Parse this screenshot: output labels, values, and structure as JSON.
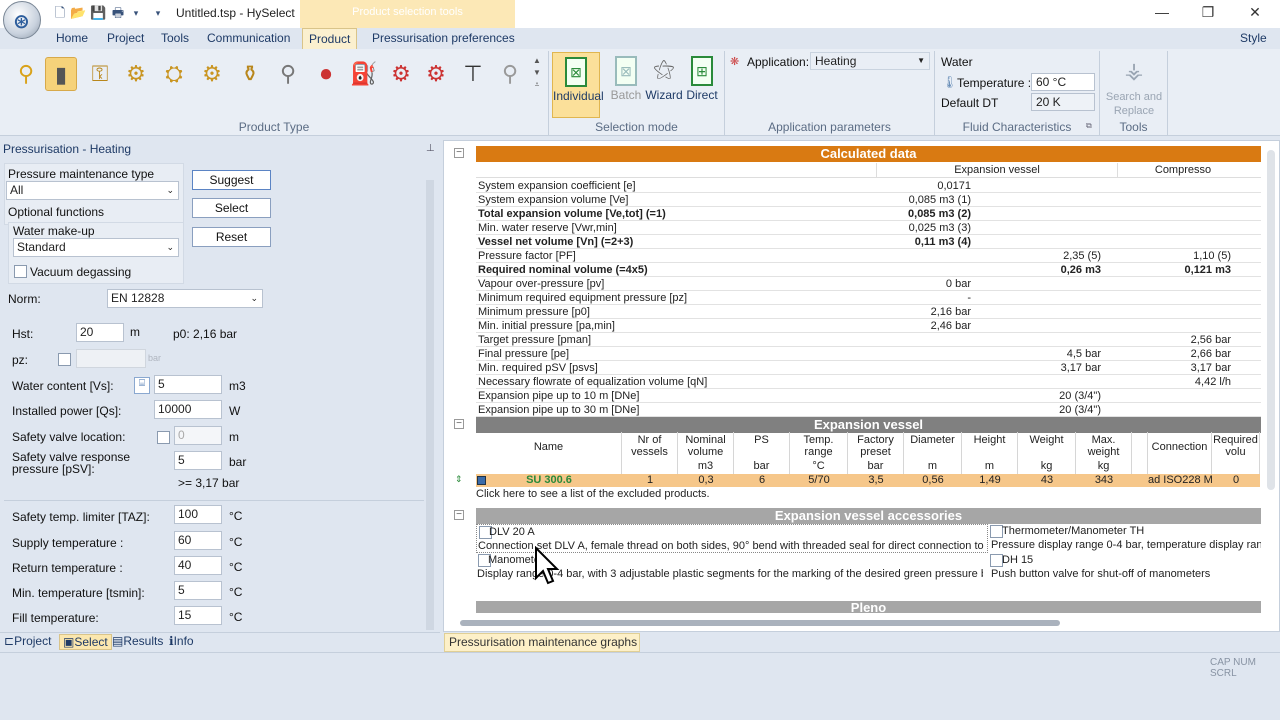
{
  "window": {
    "title": "Untitled.tsp - HySelect",
    "context_tab": "Product selection tools",
    "style_label": "Style"
  },
  "tabs": [
    "Home",
    "Project",
    "Tools",
    "Communication",
    "Product",
    "Pressurisation preferences"
  ],
  "ribbon": {
    "groups": {
      "product_type": "Product Type",
      "selection_mode": "Selection mode",
      "app_params": "Application parameters",
      "fluid": "Fluid Characteristics",
      "tools": "Tools"
    },
    "modes": [
      "Individual",
      "Batch",
      "Wizard",
      "Direct"
    ],
    "application_label": "Application:",
    "application_value": "Heating",
    "fluid_name": "Water",
    "temperature_label": "Temperature :",
    "temperature_value": "60 °C",
    "dt_label": "Default DT",
    "dt_value": "20 K",
    "search_replace": "Search and Replace"
  },
  "left": {
    "header": "Pressurisation - Heating",
    "pm_type_label": "Pressure maintenance type",
    "pm_type_value": "All",
    "optional_label": "Optional functions",
    "makeup_label": "Water make-up",
    "makeup_value": "Standard",
    "vacuum_label": "Vacuum degassing",
    "suggest": "Suggest",
    "select": "Select",
    "reset": "Reset",
    "norm_label": "Norm:",
    "norm_value": "EN 12828",
    "hst_label": "Hst:",
    "hst_value": "20",
    "hst_unit": "m",
    "p0": "p0: 2,16 bar",
    "pz_label": "pz:",
    "pz_unit": "bar",
    "vs_label": "Water content [Vs]:",
    "vs_value": "5",
    "vs_unit": "m3",
    "qs_label": "Installed power [Qs]:",
    "qs_value": "10000",
    "qs_unit": "W",
    "svloc_label": "Safety valve location:",
    "svloc_value": "0",
    "svloc_unit": "m",
    "psv_label": "Safety valve response pressure [pSV]:",
    "psv_value": "5",
    "psv_unit": "bar",
    "psv_min": ">= 3,17 bar",
    "taz_label": "Safety temp. limiter [TAZ]:",
    "taz_value": "100",
    "supply_label": "Supply temperature :",
    "supply_value": "60",
    "return_label": "Return temperature :",
    "return_value": "40",
    "tmin_label": "Min. temperature [tsmin]:",
    "tmin_value": "5",
    "fill_label": "Fill temperature:",
    "fill_value": "15",
    "temp_unit": "°C",
    "bottom_tabs": [
      "Project",
      "Select",
      "Results",
      "Info"
    ]
  },
  "calc": {
    "title": "Calculated data",
    "col1": "Expansion vessel",
    "col2": "Compresso",
    "rows": [
      {
        "a": "System expansion coefficient [e]",
        "b": "0,0171",
        "c": "",
        "d": ""
      },
      {
        "a": "System expansion volume [Ve]",
        "b": "0,085 m3 (1)",
        "c": "",
        "d": ""
      },
      {
        "a": "Total expansion volume [Ve,tot] (=1)",
        "b": "0,085 m3 (2)",
        "c": "",
        "d": "",
        "bold": true
      },
      {
        "a": "Min. water reserve [Vwr,min]",
        "b": "0,025 m3 (3)",
        "c": "",
        "d": ""
      },
      {
        "a": "Vessel net volume [Vn] (=2+3)",
        "b": "0,11 m3 (4)",
        "c": "",
        "d": "",
        "bold": true
      },
      {
        "a": "Pressure factor [PF]",
        "b": "",
        "c": "2,35 (5)",
        "d": "1,10 (5)"
      },
      {
        "a": "Required nominal volume (=4x5)",
        "b": "",
        "c": "0,26 m3",
        "d": "0,121 m3",
        "bold": true
      },
      {
        "a": "Vapour over-pressure [pv]",
        "b": "0 bar",
        "c": "",
        "d": ""
      },
      {
        "a": "Minimum required equipment pressure [pz]",
        "b": "-",
        "c": "",
        "d": ""
      },
      {
        "a": "Minimum pressure [p0]",
        "b": "2,16 bar",
        "c": "",
        "d": ""
      },
      {
        "a": "Min. initial pressure [pa,min]",
        "b": "2,46 bar",
        "c": "",
        "d": ""
      },
      {
        "a": "Target pressure [pman]",
        "b": "",
        "c": "",
        "d": "2,56 bar"
      },
      {
        "a": "Final pressure [pe]",
        "b": "",
        "c": "4,5 bar",
        "d": "2,66 bar"
      },
      {
        "a": "Min. required pSV [psvs]",
        "b": "",
        "c": "3,17 bar",
        "d": "3,17 bar"
      },
      {
        "a": "Necessary flowrate of equalization volume [qN]",
        "b": "",
        "c": "",
        "d": "4,42 l/h"
      },
      {
        "a": "Expansion pipe up to 10 m [DNe]",
        "b": "",
        "c": "20 (3/4\")",
        "d": ""
      },
      {
        "a": "Expansion pipe up to 30 m [DNe]",
        "b": "",
        "c": "20 (3/4\")",
        "d": ""
      }
    ]
  },
  "vessel": {
    "title": "Expansion vessel",
    "headers": [
      "Name",
      "Nr of vessels",
      "Nominal volume",
      "PS",
      "Temp. range",
      "Factory preset",
      "Diameter",
      "Height",
      "Weight",
      "Max. weight",
      "",
      "Connection",
      "Required volu"
    ],
    "units": [
      "",
      "",
      "m3",
      "bar",
      "°C",
      "bar",
      "m",
      "m",
      "kg",
      "kg",
      "",
      "",
      ""
    ],
    "row": [
      "SU 300.6",
      "1",
      "0,3",
      "6",
      "5/70",
      "3,5",
      "0,56",
      "1,49",
      "43",
      "343",
      "",
      "ad ISO228 Ma",
      "0"
    ],
    "excluded": "Click here to see a list of the excluded products."
  },
  "accessories": {
    "title": "Expansion vessel accessories",
    "items": [
      {
        "name": "DLV 20 A",
        "desc": "Connection set DLV A, female thread on both sides, 90° bend with threaded seal for direct connection to Stati"
      },
      {
        "name": "Thermometer/Manometer TH",
        "desc": "Pressure display range 0-4 bar, temperature display range"
      },
      {
        "name": "Manometer",
        "desc": "Display range 0-4 bar, with 3 adjustable plastic segments for the marking of the desired green pressure band..."
      },
      {
        "name": "DH 15",
        "desc": "Push button valve for shut-off of manometers"
      }
    ],
    "next": "Pleno"
  },
  "graphs_tab": "Pressurisation maintenance graphs",
  "status": "CAP NUM SCRL"
}
